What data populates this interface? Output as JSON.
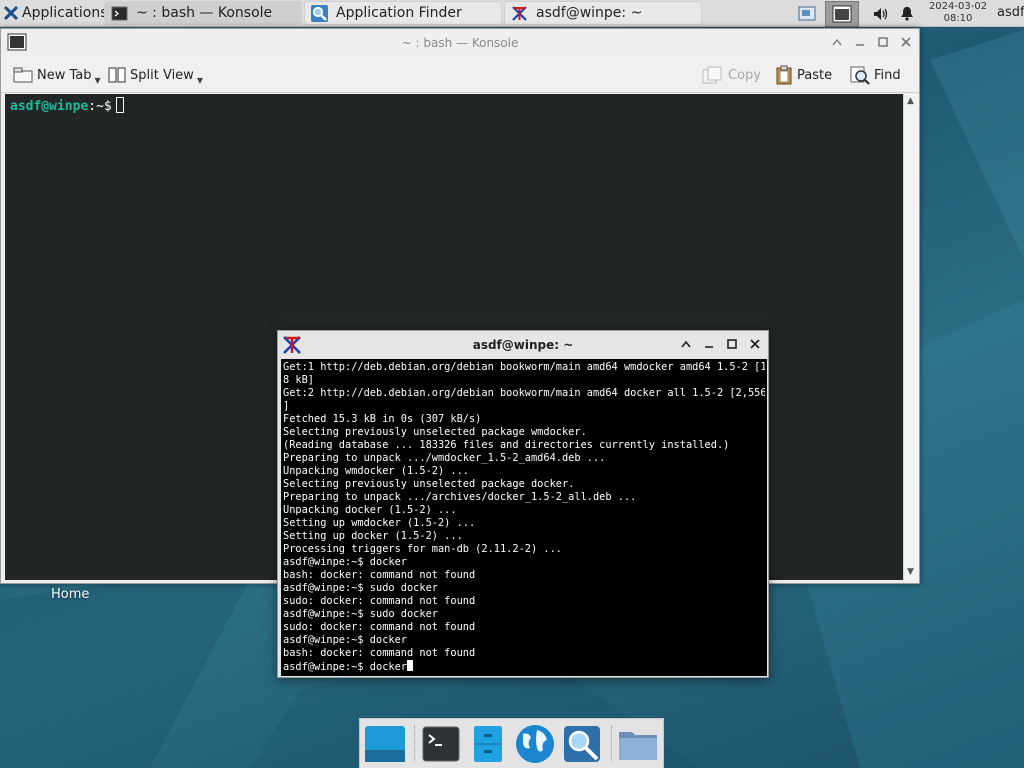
{
  "top_panel": {
    "applications_label": "Applications",
    "tasks": [
      {
        "label": "~ : bash — Konsole"
      },
      {
        "label": "Application Finder"
      },
      {
        "label": "asdf@winpe: ~"
      }
    ],
    "clock": {
      "date": "2024-03-02",
      "time": "08:10"
    },
    "user": "asdf"
  },
  "konsole": {
    "title": "~ : bash — Konsole",
    "toolbar": {
      "new_tab": "New Tab",
      "split_view": "Split View",
      "copy": "Copy",
      "paste": "Paste",
      "find": "Find"
    },
    "prompt_user": "asdf@winpe",
    "prompt_rest": ":~$"
  },
  "desktop": {
    "home_label": "Home"
  },
  "xterm": {
    "title": "asdf@winpe: ~",
    "lines": [
      "Get:1 http://deb.debian.org/debian bookworm/main amd64 wmdocker amd64 1.5-2 [12.",
      "8 kB]",
      "Get:2 http://deb.debian.org/debian bookworm/main amd64 docker all 1.5-2 [2,556 B",
      "]",
      "Fetched 15.3 kB in 0s (307 kB/s)",
      "Selecting previously unselected package wmdocker.",
      "(Reading database ... 183326 files and directories currently installed.)",
      "Preparing to unpack .../wmdocker_1.5-2_amd64.deb ...",
      "Unpacking wmdocker (1.5-2) ...",
      "Selecting previously unselected package docker.",
      "Preparing to unpack .../archives/docker_1.5-2_all.deb ...",
      "Unpacking docker (1.5-2) ...",
      "Setting up wmdocker (1.5-2) ...",
      "Setting up docker (1.5-2) ...",
      "Processing triggers for man-db (2.11.2-2) ...",
      "asdf@winpe:~$ docker",
      "bash: docker: command not found",
      "asdf@winpe:~$ sudo docker",
      "sudo: docker: command not found",
      "asdf@winpe:~$ sudo docker",
      "sudo: docker: command not found",
      "asdf@winpe:~$ docker",
      "bash: docker: command not found"
    ],
    "current_line": "asdf@winpe:~$ docker"
  },
  "dock": {
    "items": [
      "show-desktop",
      "terminal",
      "file-manager",
      "web-browser",
      "app-finder",
      "folder"
    ]
  },
  "colors": {
    "konsole_bg": "#232627",
    "prompt_user": "#1abc9c",
    "panel_bg": "#dcdcdc"
  }
}
